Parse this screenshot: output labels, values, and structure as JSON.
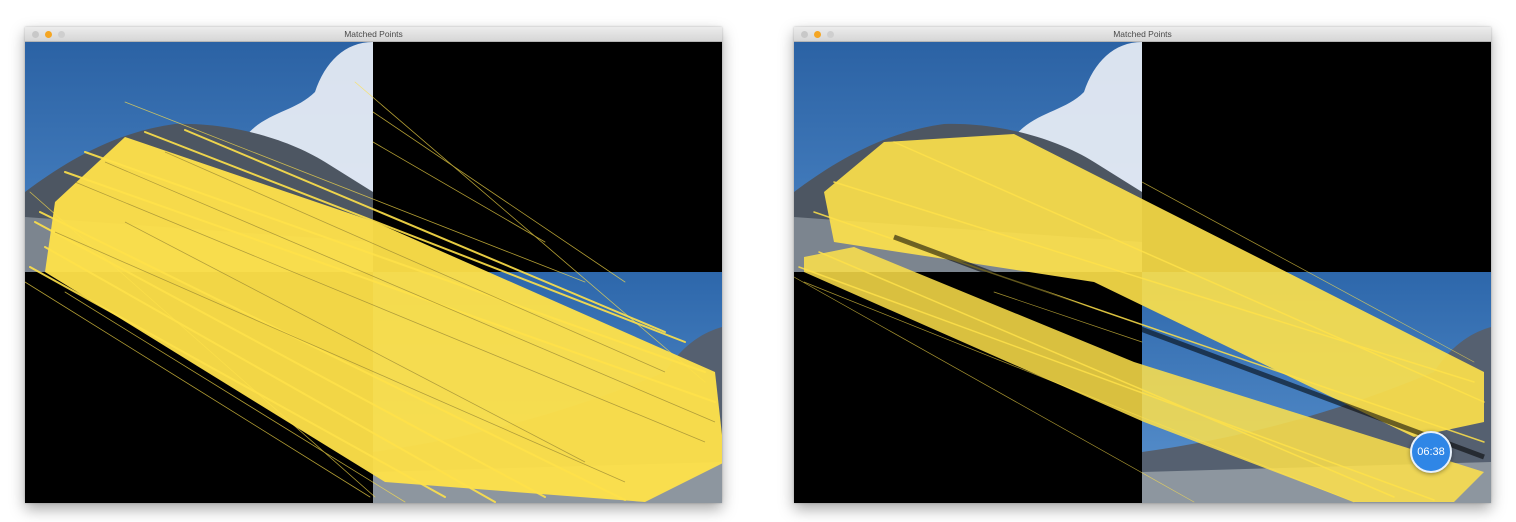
{
  "windows": [
    {
      "title": "Matched Points",
      "traffic_lights": {
        "close": "#c8c8c8",
        "minimize": "#f5a623",
        "zoom": "#cfcfcf"
      },
      "image": "feature-matches-dense",
      "match_line_color": "#ffe24a"
    },
    {
      "title": "Matched Points",
      "traffic_lights": {
        "close": "#c8c8c8",
        "minimize": "#f5a623",
        "zoom": "#cfcfcf"
      },
      "image": "feature-matches-sparse",
      "match_line_color": "#ffe24a"
    }
  ],
  "timer": {
    "label": "06:38",
    "color": "#2f86e6"
  }
}
